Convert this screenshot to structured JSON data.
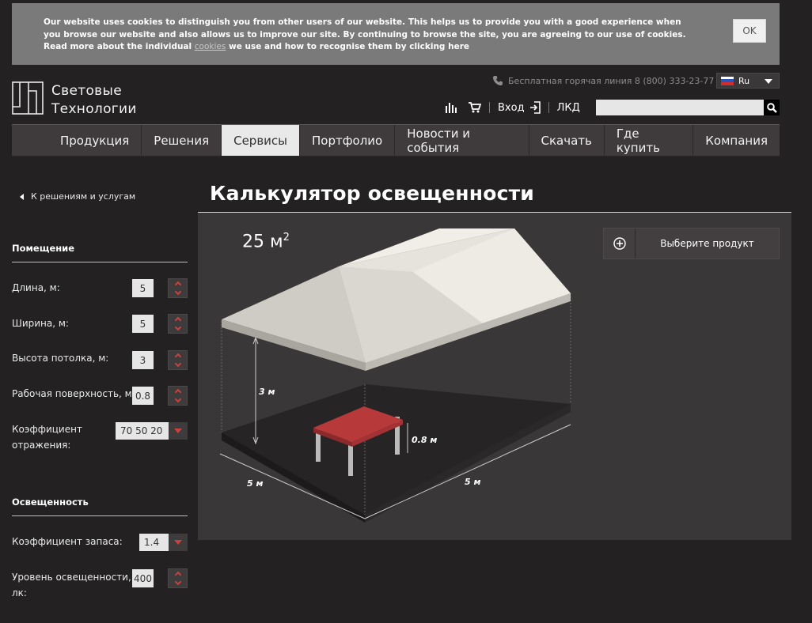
{
  "cookie": {
    "text": "Our website uses cookies to distinguish you from other users of our website. This helps us to provide you with a good experience when you browse our website and also allows us to improve our site. By continuing to browse the site, you are agreeing to our use of cookies. Read more about the individual",
    "link": "cookies",
    "text_after": "we use and how to recognise them by clicking here",
    "ok_label": "OK"
  },
  "header": {
    "logo_line1": "Световые",
    "logo_line2": "Технологии",
    "hotline": "Бесплатная горячая линия 8 (800) 333-23-77",
    "lang": "Ru",
    "login": "Вход",
    "lkd": "ЛКД",
    "search_placeholder": ""
  },
  "nav": {
    "items": [
      "Продукция",
      "Решения",
      "Сервисы",
      "Портфолио",
      "Новости и события",
      "Скачать",
      "Где купить",
      "Компания"
    ],
    "active_index": 2
  },
  "page": {
    "back_label": "К решениям и услугам",
    "title": "Калькулятор освещенности"
  },
  "form": {
    "room_header": "Помещение",
    "length_label": "Длина, м:",
    "length_value": "5",
    "width_label": "Ширина, м:",
    "width_value": "5",
    "height_label": "Высота потолка, м:",
    "height_value": "3",
    "surface_label": "Рабочая поверхность, м:",
    "surface_value": "0.8",
    "reflection_label_1": "Коэффициент",
    "reflection_label_2": "отражения:",
    "reflection_value": "70 50 20",
    "illum_header": "Освещенность",
    "reserve_label": "Коэффициент запаса:",
    "reserve_value": "1.4",
    "level_label_1": "Уровень освещенности,",
    "level_label_2": "лк:",
    "level_value": "400"
  },
  "scene": {
    "area": "25 м",
    "area_sup": "2",
    "product_label": "Выберите продукт",
    "dim_height": "3 м",
    "dim_table": "0.8 м",
    "dim_left": "5 м",
    "dim_right": "5 м"
  },
  "colors": {
    "background": "#232122",
    "nav": "#3f3b3c",
    "accent_red": "#c9423f",
    "table_red": "#b8393a"
  }
}
